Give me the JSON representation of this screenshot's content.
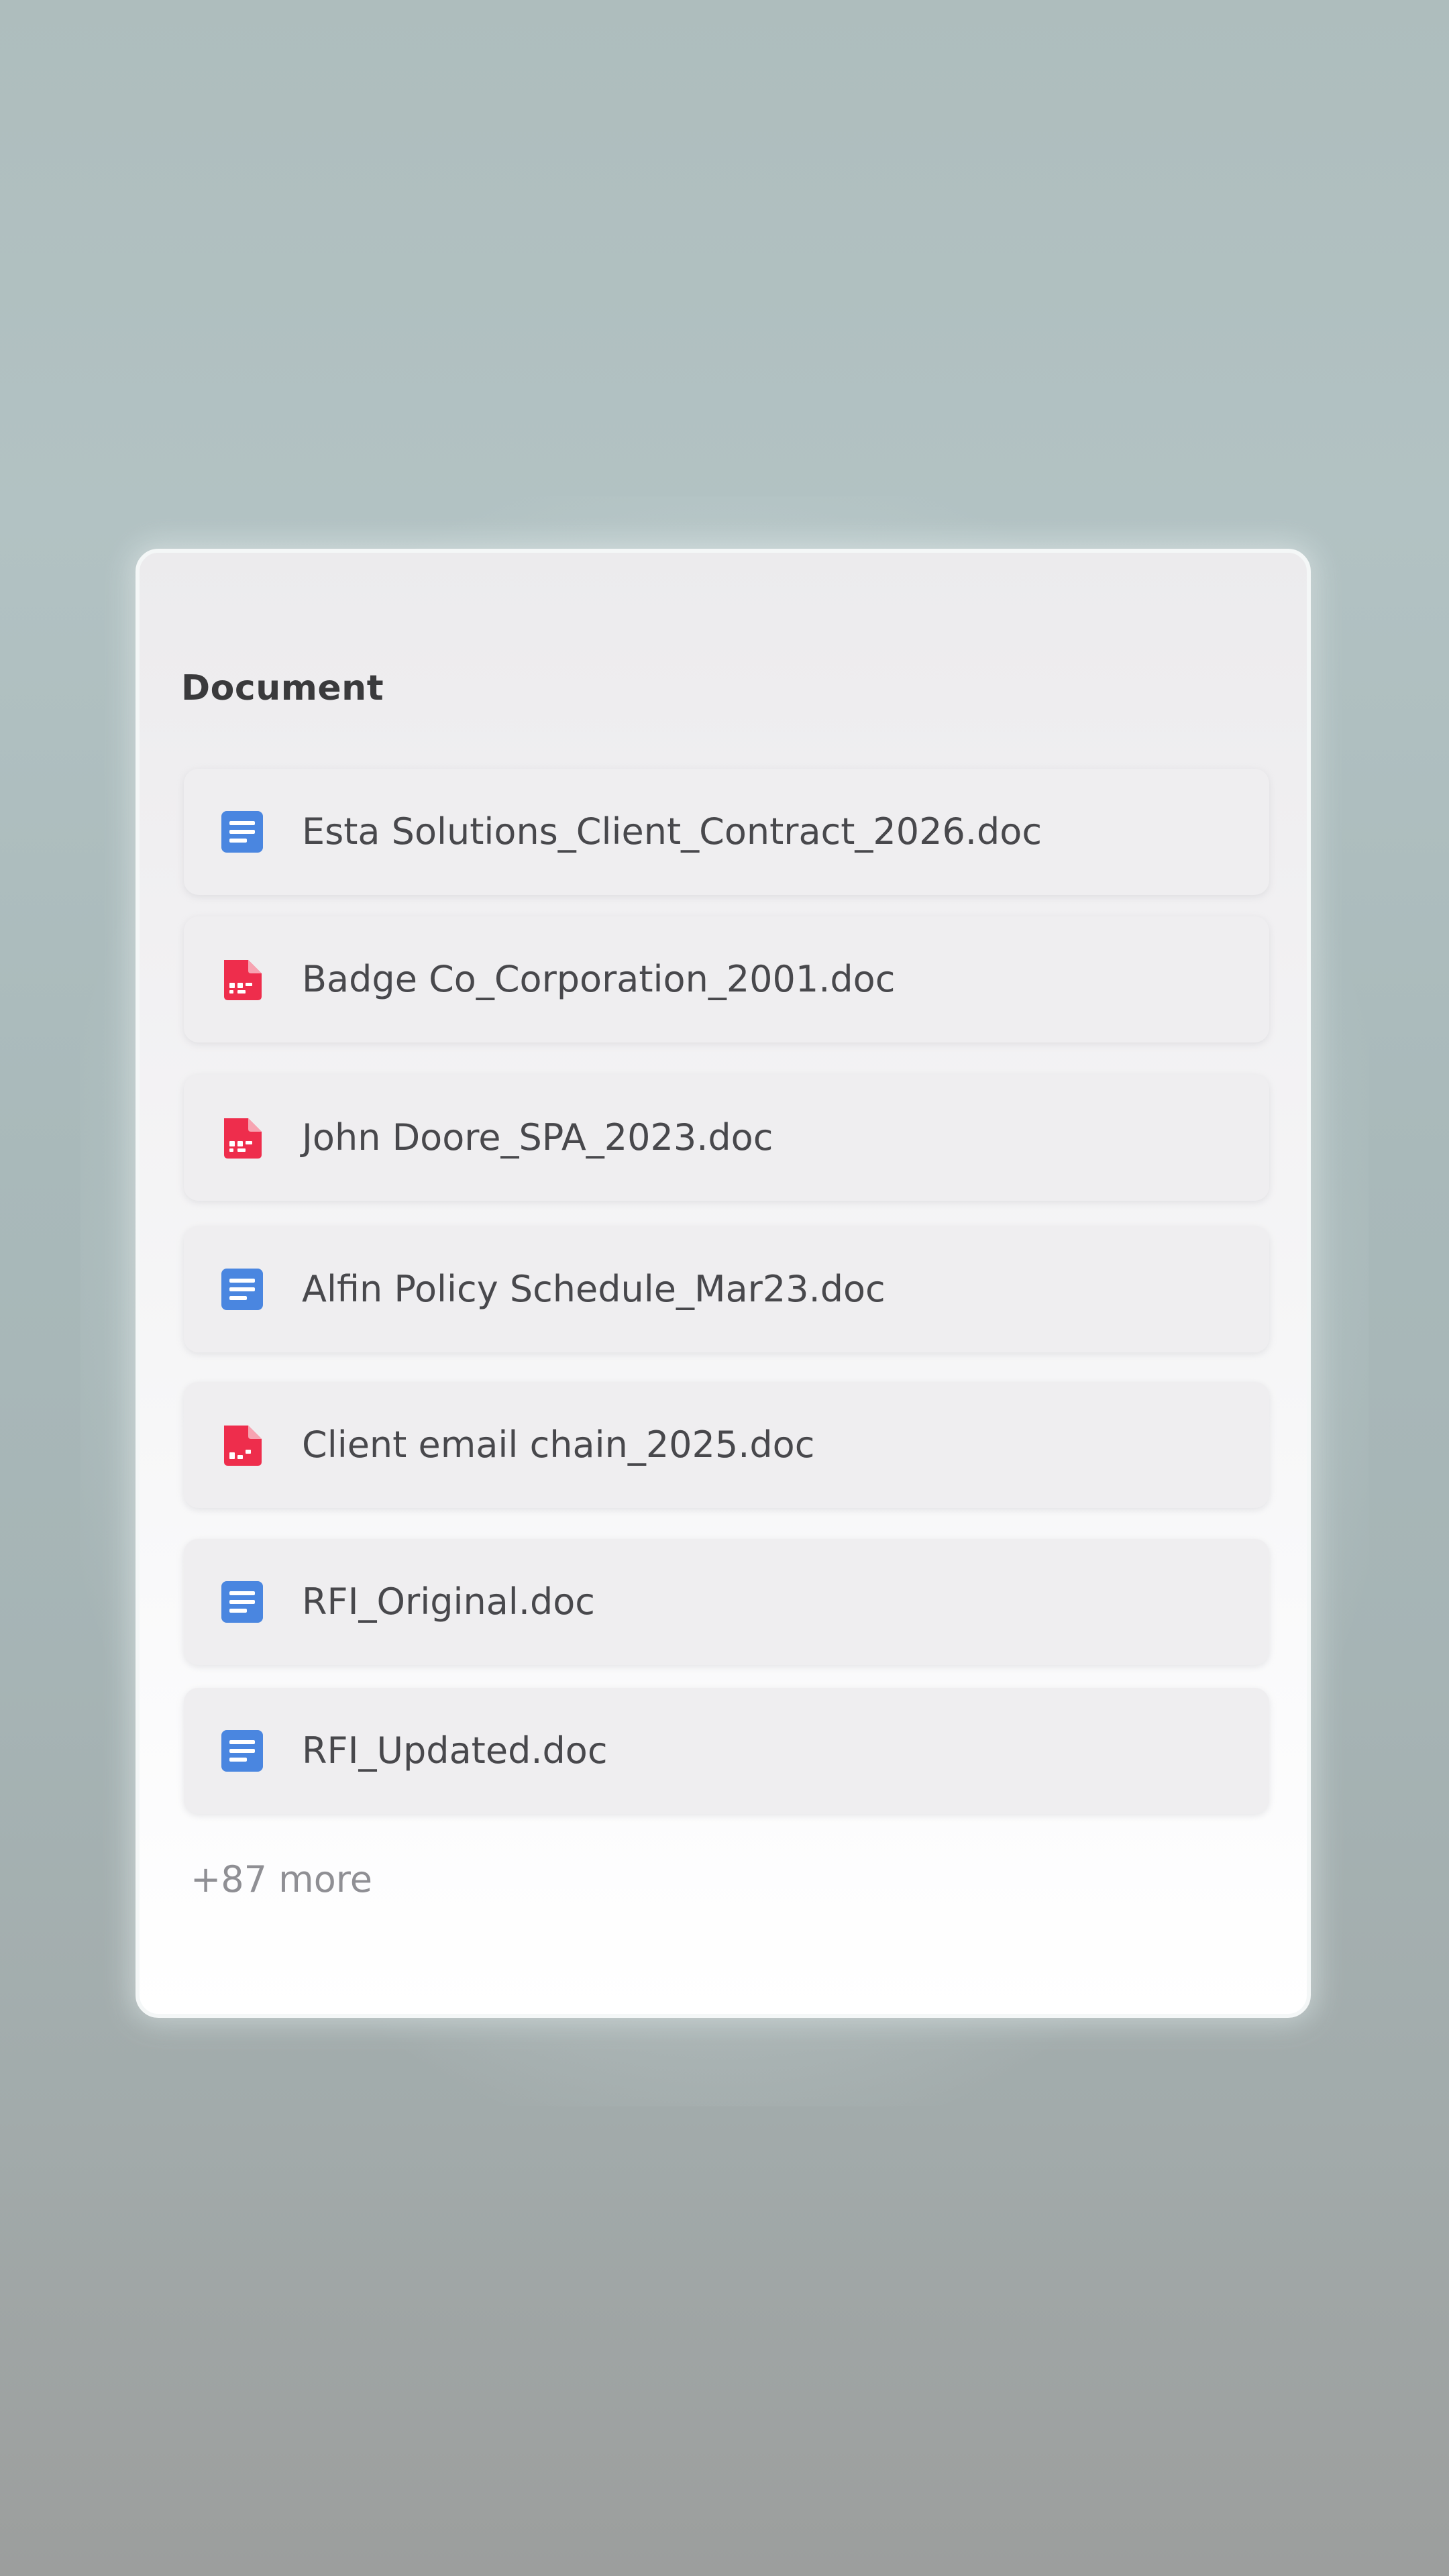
{
  "panel": {
    "title": "Document",
    "files": [
      {
        "name": "Esta Solutions_Client_Contract_2026.doc",
        "icon": "doc-icon",
        "color": "#4a86e0"
      },
      {
        "name": "Badge Co_Corporation_2001.doc",
        "icon": "pdf-icon",
        "color": "#ee2d4c"
      },
      {
        "name": "John Doore_SPA_2023.doc",
        "icon": "pdf-icon",
        "color": "#ee2d4c"
      },
      {
        "name": "Alfin Policy Schedule_Mar23.doc",
        "icon": "doc-icon",
        "color": "#4a86e0"
      },
      {
        "name": "Client email chain_2025.doc",
        "icon": "pdf-icon",
        "color": "#ee2d4c"
      },
      {
        "name": "RFI_Original.doc",
        "icon": "doc-icon",
        "color": "#4a86e0"
      },
      {
        "name": "RFI_Updated.doc",
        "icon": "doc-icon",
        "color": "#4a86e0"
      }
    ],
    "more_label": "+87 more"
  }
}
